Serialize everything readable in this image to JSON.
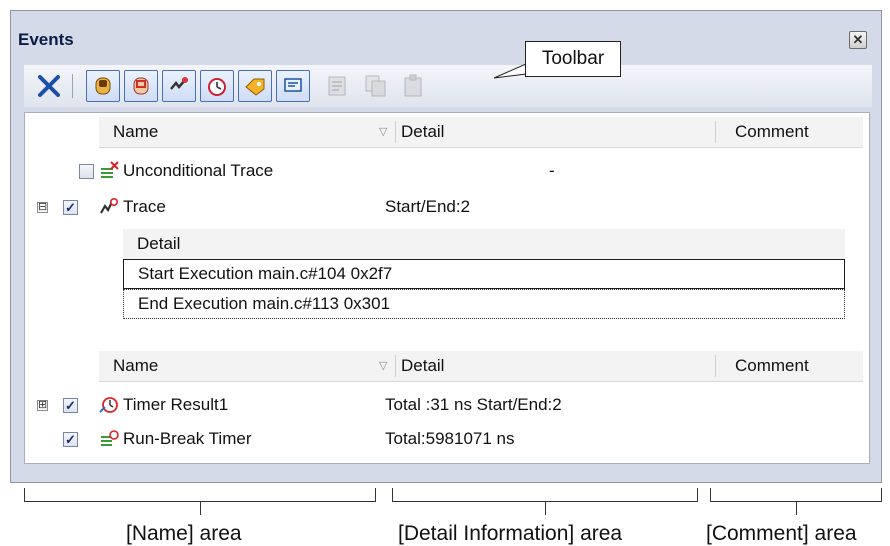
{
  "window": {
    "title": "Events",
    "close_glyph": "✕"
  },
  "toolbar": {
    "callout": "Toolbar",
    "buttons": [
      {
        "icon": "delete-icon",
        "enabled": true
      },
      {
        "icon": "hardware-break-icon",
        "enabled": true
      },
      {
        "icon": "software-break-icon",
        "enabled": true
      },
      {
        "icon": "trace-icon",
        "enabled": true
      },
      {
        "icon": "timer-icon",
        "enabled": true
      },
      {
        "icon": "action-event-icon",
        "enabled": true
      },
      {
        "icon": "point-trace-icon",
        "enabled": true
      },
      {
        "icon": "edit-condition-icon",
        "enabled": false
      },
      {
        "icon": "copy-icon",
        "enabled": false
      },
      {
        "icon": "paste-icon",
        "enabled": false
      }
    ],
    "accent": "#1c4fa8"
  },
  "columns": {
    "name": "Name",
    "detail": "Detail",
    "comment": "Comment",
    "sort_glyph": "▽"
  },
  "events_top": [
    {
      "name": "Unconditional Trace",
      "detail": "-",
      "checked": false,
      "expandable": false
    },
    {
      "name": "Trace",
      "detail": "Start/End:2",
      "checked": true,
      "expandable": true,
      "expanded": true,
      "expander": "⊟"
    }
  ],
  "trace_detail": {
    "header": "Detail",
    "rows": [
      "Start Execution main.c#104 0x2f7",
      "End Execution main.c#113 0x301"
    ]
  },
  "events_bottom": [
    {
      "name": "Timer Result1",
      "detail": "Total :31 ns  Start/End:2",
      "checked": true,
      "expandable": true,
      "expander": "⊞"
    },
    {
      "name": "Run-Break Timer",
      "detail": "Total:5981071 ns",
      "checked": true,
      "expandable": false
    }
  ],
  "areas": {
    "name": "[Name] area",
    "detail": "[Detail Information] area",
    "comment": "[Comment] area"
  }
}
